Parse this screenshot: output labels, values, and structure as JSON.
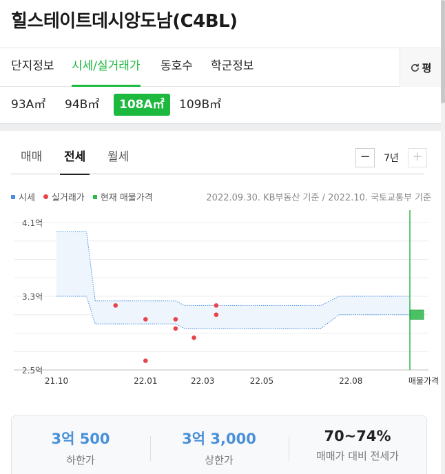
{
  "page_title": "힐스테이트데시앙도남(C4BL)",
  "main_tabs": [
    {
      "label": "단지정보"
    },
    {
      "label": "시세/실거래가"
    },
    {
      "label": "동호수"
    },
    {
      "label": "학군정보"
    }
  ],
  "unit_toggle_label": "평",
  "area_tabs": [
    {
      "label": "93A㎡"
    },
    {
      "label": "94B㎡"
    },
    {
      "label": "108A㎡"
    },
    {
      "label": "109B㎡"
    }
  ],
  "trade_tabs": [
    {
      "label": "매매"
    },
    {
      "label": "전세"
    },
    {
      "label": "월세"
    }
  ],
  "period": {
    "minus": "−",
    "value": "7년",
    "plus": "+"
  },
  "legend": [
    {
      "label": "시세",
      "color": "#4a90e2"
    },
    {
      "label": "실거래가",
      "color": "#e8454a"
    },
    {
      "label": "현재 매물가격",
      "color": "#2db84a"
    }
  ],
  "basis_text": "2022.09.30. KB부동산 기준 / 2022.10. 국토교통부 기준",
  "colors": {
    "accent": "#1db93f",
    "band_fill": "#eef5fc",
    "band_line": "#4a90e2",
    "deal": "#e8454a",
    "listing": "#2db84a"
  },
  "chart_data": {
    "type": "area",
    "y_tick_labels": [
      "4.1억",
      "3.3억",
      "2.5억"
    ],
    "y_ticks": [
      4.1,
      3.3,
      2.5
    ],
    "ylim": [
      2.5,
      4.1
    ],
    "x_tick_labels": [
      "21.10",
      "22.01",
      "22.03",
      "22.05",
      "22.08",
      "매물가격"
    ],
    "x_ticks": [
      "2021-10-01",
      "2022-01-01",
      "2022-03-01",
      "2022-05-01",
      "2022-08-01"
    ],
    "xlim": [
      "2021-10-01",
      "2022-10-01"
    ],
    "series": [
      {
        "name": "시세",
        "points": [
          {
            "x": "2021-10-01",
            "low": 3.3,
            "high": 4.0
          },
          {
            "x": "2021-11-01",
            "low": 3.3,
            "high": 4.0
          },
          {
            "x": "2021-11-10",
            "low": 3.0,
            "high": 3.25
          },
          {
            "x": "2022-02-01",
            "low": 3.0,
            "high": 3.25
          },
          {
            "x": "2022-02-10",
            "low": 2.95,
            "high": 3.2
          },
          {
            "x": "2022-07-01",
            "low": 2.95,
            "high": 3.2
          },
          {
            "x": "2022-07-20",
            "low": 3.1,
            "high": 3.3
          },
          {
            "x": "2022-10-01",
            "low": 3.1,
            "high": 3.3
          }
        ]
      },
      {
        "name": "실거래가",
        "points": [
          {
            "x": "2021-12-01",
            "y": 3.2
          },
          {
            "x": "2022-01-01",
            "y": 3.05
          },
          {
            "x": "2022-01-01",
            "y": 2.6
          },
          {
            "x": "2022-02-01",
            "y": 3.05
          },
          {
            "x": "2022-02-01",
            "y": 2.95
          },
          {
            "x": "2022-02-20",
            "y": 2.85
          },
          {
            "x": "2022-03-15",
            "y": 3.2
          },
          {
            "x": "2022-03-15",
            "y": 3.1
          }
        ]
      },
      {
        "name": "현재 매물가격",
        "low": 3.05,
        "high": 3.15
      }
    ],
    "grid": true
  },
  "summary": [
    {
      "value": "3억 500",
      "label": "하한가"
    },
    {
      "value": "3억 3,000",
      "label": "상한가"
    },
    {
      "value": "70~74%",
      "label": "매매가 대비 전세가"
    }
  ]
}
